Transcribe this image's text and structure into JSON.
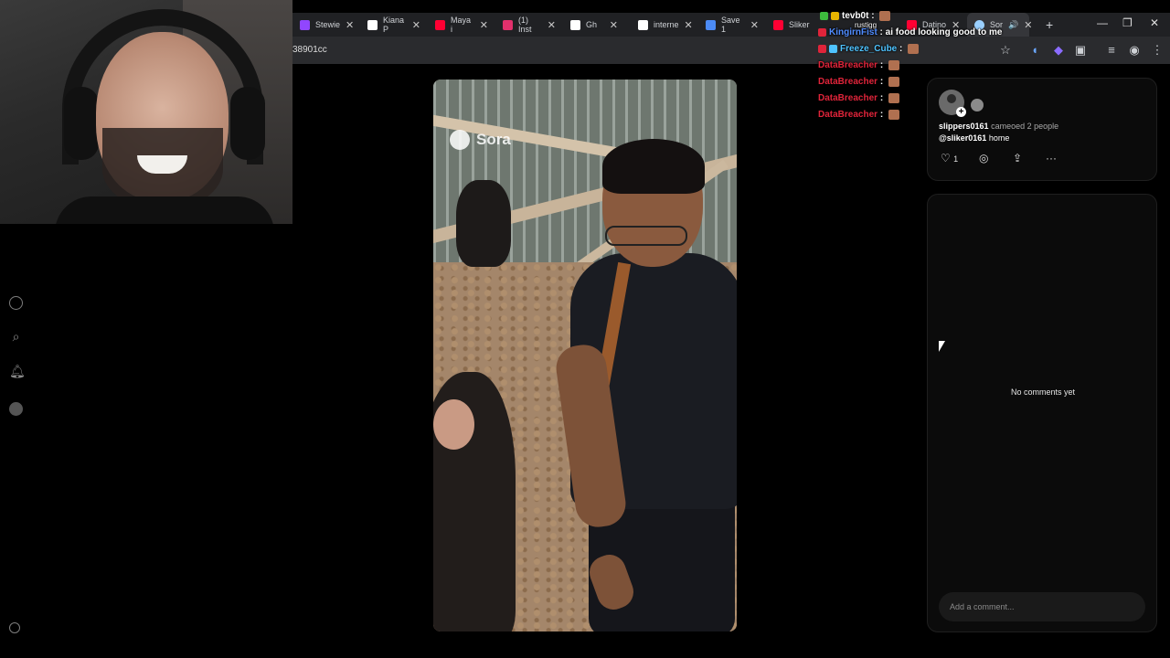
{
  "tabs": [
    {
      "label": "Stewie",
      "color": "#9146ff"
    },
    {
      "label": "Kiana P",
      "color": "#ffffff"
    },
    {
      "label": "Maya i",
      "color": "#ff0033"
    },
    {
      "label": "(1) Inst",
      "color": "#e1306c"
    },
    {
      "label": "Gh",
      "color": "#ffffff"
    },
    {
      "label": "interne",
      "color": "#ffffff"
    },
    {
      "label": "Save 1",
      "color": "#4c8bf5"
    },
    {
      "label": "Sliker",
      "color": "#ff0033"
    },
    {
      "label": "Datino",
      "color": "#ff0033"
    },
    {
      "label": "Sor",
      "color": "#9ad0ff"
    }
  ],
  "url": "38901cc",
  "chat": [
    {
      "user": "KingirnFist",
      "user_color": "#4f8cff",
      "text": "ai food looking good to me"
    },
    {
      "user": "Freeze_Cube",
      "user_color": "#4fc3ff",
      "text": ""
    },
    {
      "user": "DataBreacher",
      "user_color": "#e0243a",
      "text": ""
    },
    {
      "user": "DataBreacher",
      "user_color": "#e0243a",
      "text": ""
    },
    {
      "user": "DataBreacher",
      "user_color": "#e0243a",
      "text": ""
    },
    {
      "user": "DataBreacher",
      "user_color": "#e0243a",
      "text": ""
    }
  ],
  "chat_top": {
    "user": "tevb0t",
    "sub": "rustigg"
  },
  "watermark": "Sora",
  "post": {
    "author": "slippers0161",
    "action_text": "cameoed 2 people",
    "mention": "@sliker0161",
    "caption_rest": "home",
    "likes": "1"
  },
  "comments": {
    "empty_text": "No comments yet",
    "placeholder": "Add a comment..."
  }
}
